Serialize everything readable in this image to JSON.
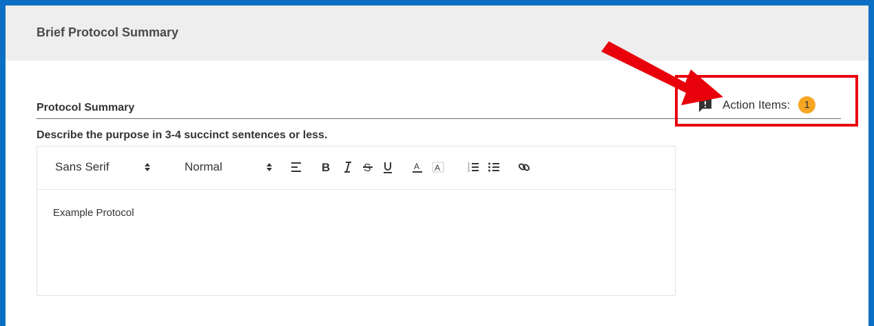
{
  "section": {
    "title": "Brief Protocol Summary"
  },
  "field": {
    "label": "Protocol Summary",
    "help": "Describe the purpose in 3-4 succinct sentences or less."
  },
  "toolbar": {
    "font_family": "Sans Serif",
    "font_size": "Normal",
    "align_icon": "align-left-icon",
    "bold_icon": "bold-icon",
    "italic_icon": "italic-icon",
    "strike_icon": "strikethrough-icon",
    "underline_icon": "underline-icon",
    "text_color_icon": "text-color-icon",
    "background_color_icon": "background-color-icon",
    "ordered_list_icon": "ordered-list-icon",
    "bullet_list_icon": "bullet-list-icon",
    "link_icon": "link-icon"
  },
  "editor": {
    "content": "Example Protocol"
  },
  "action_items": {
    "label": "Action Items:",
    "count": "1",
    "icon": "feedback-icon"
  },
  "colors": {
    "frame_border": "#0b6fc4",
    "header_bg": "#eeeeee",
    "highlight_red": "#e8000b",
    "badge": "#f5a623"
  }
}
